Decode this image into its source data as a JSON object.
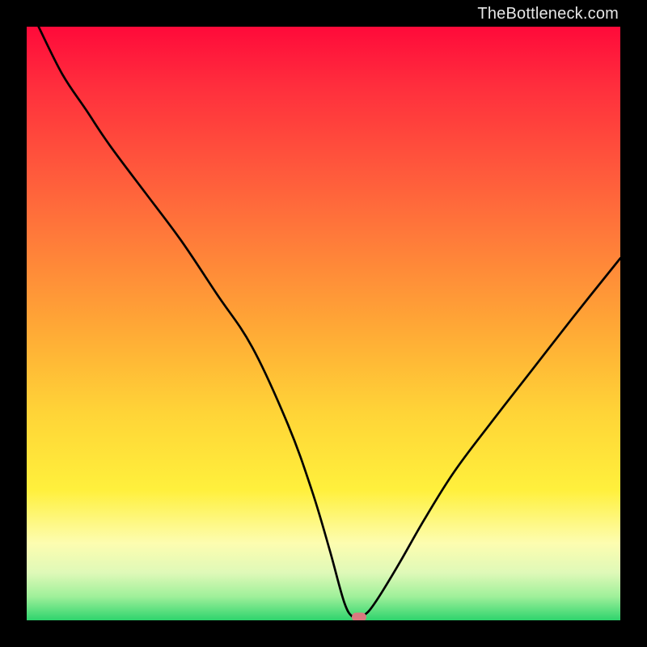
{
  "watermark": {
    "text": "TheBottleneck.com"
  },
  "chart_data": {
    "type": "line",
    "title": "",
    "xlabel": "",
    "ylabel": "",
    "xlim": [
      0,
      100
    ],
    "ylim": [
      0,
      100
    ],
    "series": [
      {
        "name": "bottleneck-curve",
        "x": [
          2,
          6,
          10,
          14,
          20,
          26,
          32,
          38,
          44,
          48,
          51,
          53.5,
          55,
          56,
          57,
          58,
          60,
          63,
          67,
          72,
          78,
          85,
          92,
          100
        ],
        "values": [
          100,
          92,
          86,
          80,
          72,
          64,
          55,
          46,
          33,
          22,
          12,
          3,
          0.5,
          0.5,
          1,
          2,
          5,
          10,
          17,
          25,
          33,
          42,
          51,
          61
        ]
      }
    ],
    "marker": {
      "x": 56,
      "y": 0.5
    },
    "gradient_stops": [
      {
        "pos": 0,
        "color": "#ff0a3a"
      },
      {
        "pos": 50,
        "color": "#ffa636"
      },
      {
        "pos": 78,
        "color": "#fff03c"
      },
      {
        "pos": 100,
        "color": "#2ed46d"
      }
    ]
  }
}
